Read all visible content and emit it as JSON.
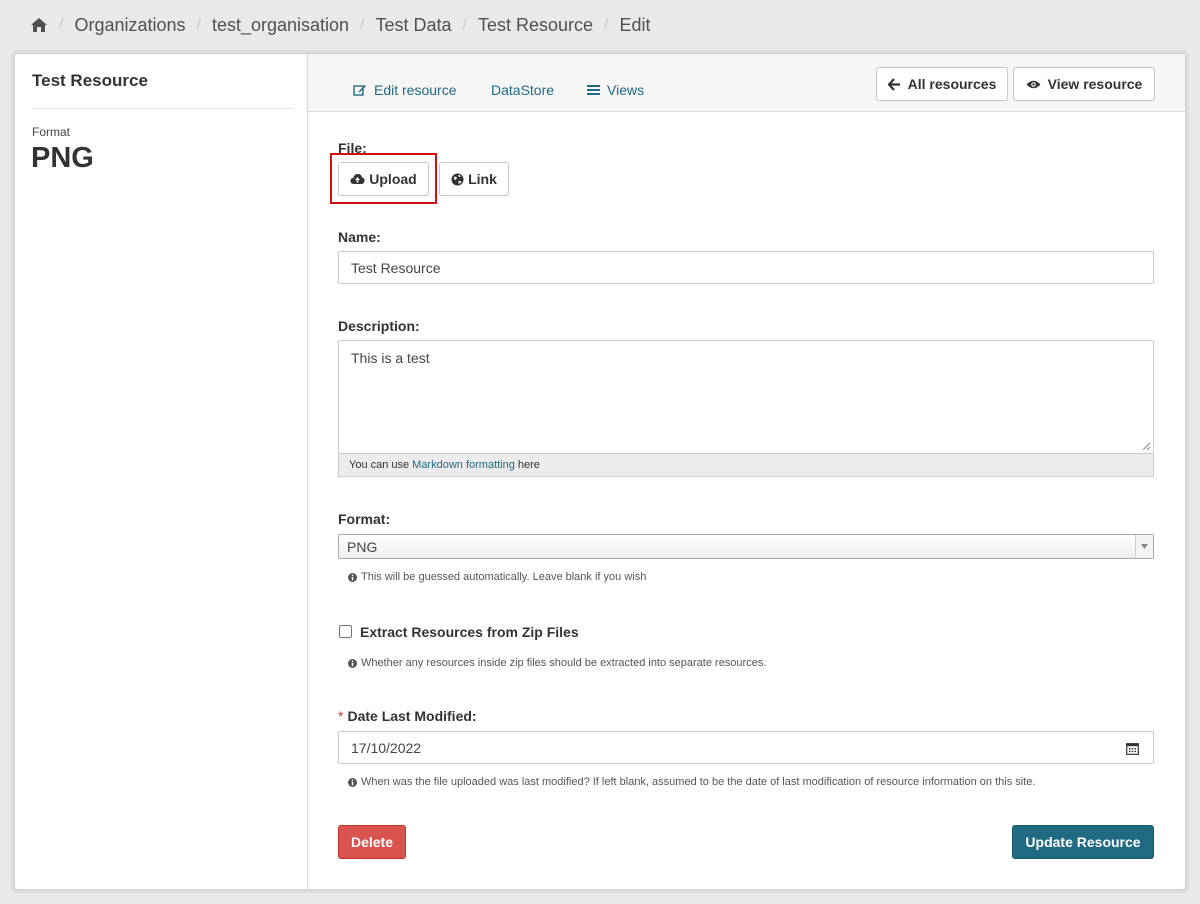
{
  "breadcrumb": {
    "home_icon": "home-icon",
    "items": [
      "Organizations",
      "test_organisation",
      "Test Data",
      "Test Resource",
      "Edit"
    ],
    "separator": "/"
  },
  "sidebar": {
    "title": "Test Resource",
    "format_label": "Format",
    "format_value": "PNG"
  },
  "tabs": [
    {
      "label": "Edit resource",
      "icon": "edit-icon"
    },
    {
      "label": "DataStore"
    },
    {
      "label": "Views",
      "icon": "list-icon"
    }
  ],
  "actions": {
    "all_resources": "All resources",
    "view_resource": "View resource"
  },
  "form": {
    "file_label": "File:",
    "upload_label": "Upload",
    "link_label": "Link",
    "name_label": "Name:",
    "name_value": "Test Resource",
    "description_label": "Description:",
    "description_value": "This is a test",
    "markdown_prefix": "You can use",
    "markdown_link": "Markdown formatting",
    "markdown_suffix": "here",
    "format_label": "Format:",
    "format_value": "PNG",
    "format_help": "This will be guessed automatically. Leave blank if you wish",
    "zip_label": "Extract Resources from Zip Files",
    "zip_help": "Whether any resources inside zip files should be extracted into separate resources.",
    "date_required_mark": "*",
    "date_label": "Date Last Modified:",
    "date_value": "17/10/2022",
    "date_help": "When was the file uploaded was last modified? If left blank, assumed to be the date of last modification of resource information on this site.",
    "delete_label": "Delete",
    "update_label": "Update Resource"
  },
  "colors": {
    "accent": "#206b82",
    "danger": "#d9534f",
    "highlight": "#d20e0e"
  }
}
